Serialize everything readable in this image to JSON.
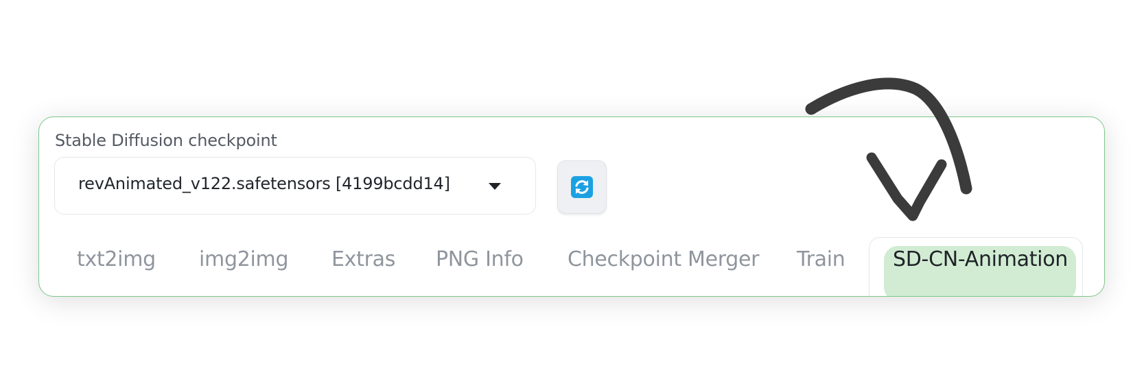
{
  "checkpoint": {
    "label": "Stable Diffusion checkpoint",
    "selected": "revAnimated_v122.safetensors [4199bcdd14]"
  },
  "refresh_button": {
    "icon": "refresh-icon",
    "color": "#1ba1e2"
  },
  "tabs": [
    {
      "label": "txt2img"
    },
    {
      "label": "img2img"
    },
    {
      "label": "Extras"
    },
    {
      "label": "PNG Info"
    },
    {
      "label": "Checkpoint Merger"
    },
    {
      "label": "Train"
    },
    {
      "label": "SD-CN-Animation",
      "active": true
    }
  ],
  "colors": {
    "panel_border": "#7cc68a",
    "active_tab_bg": "#d1ecd2",
    "inactive_tab_text": "#8f959d",
    "annotation_arrow": "#3b3b3b"
  },
  "annotation": {
    "icon": "curved-arrow-icon"
  }
}
